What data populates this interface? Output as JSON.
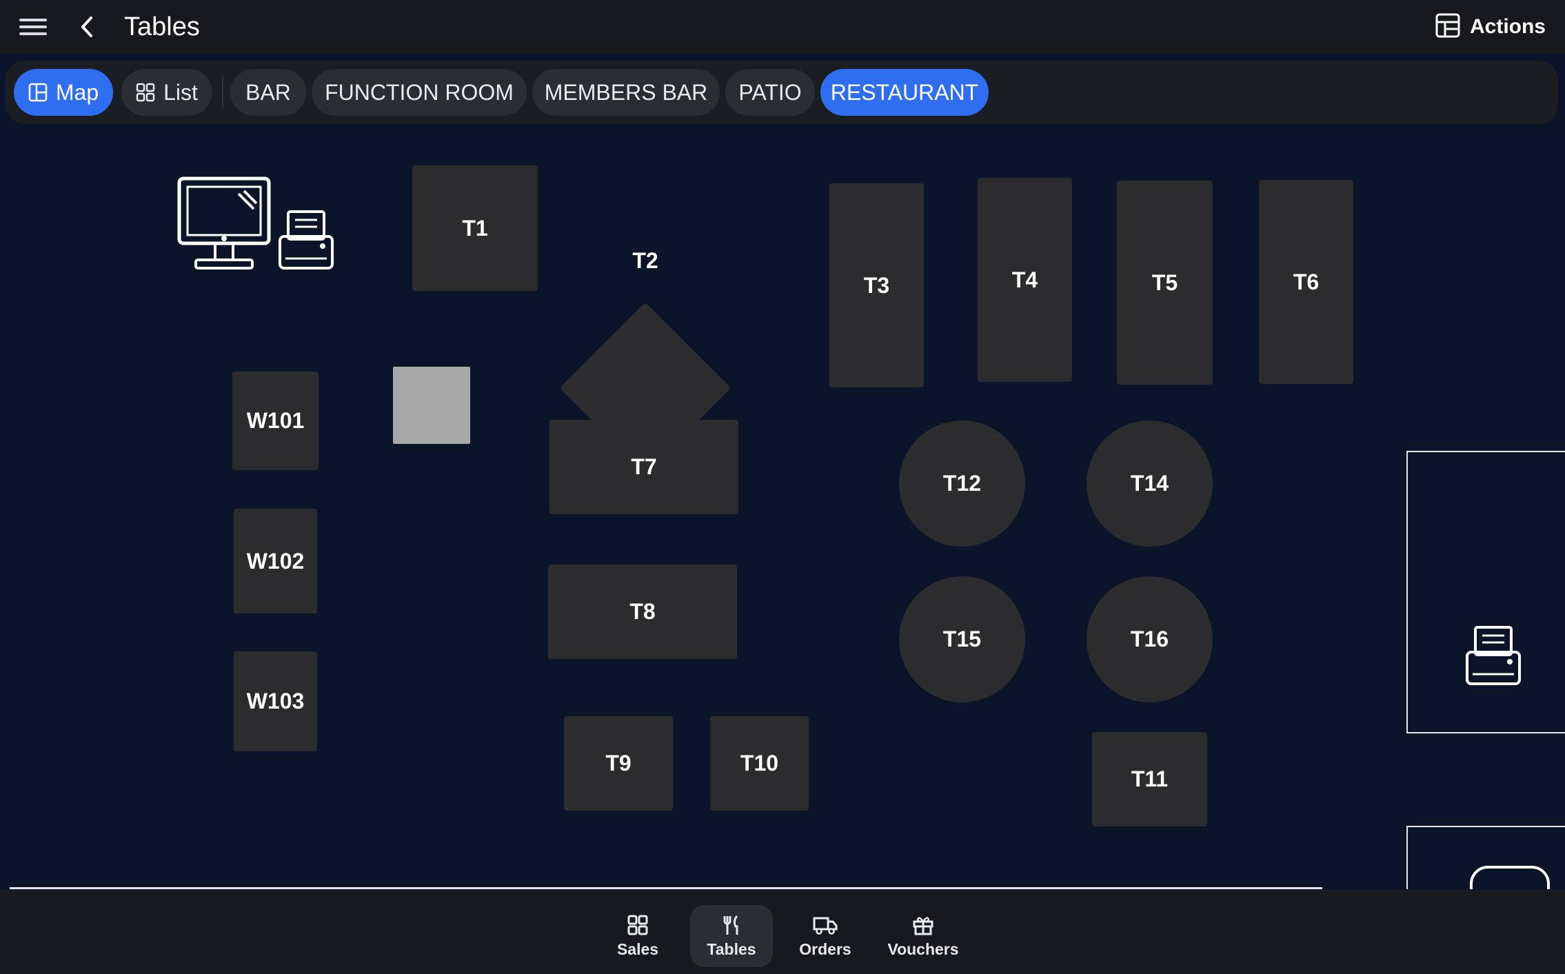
{
  "header": {
    "title": "Tables",
    "actions_label": "Actions",
    "menu_icon": "hamburger-menu-icon",
    "back_icon": "chevron-left-icon",
    "actions_icon": "layout-icon"
  },
  "view_toggle": {
    "map_label": "Map",
    "list_label": "List",
    "selected": "Map"
  },
  "areas": [
    {
      "label": "BAR",
      "active": false
    },
    {
      "label": "FUNCTION ROOM",
      "active": false
    },
    {
      "label": "MEMBERS BAR",
      "active": false
    },
    {
      "label": "PATIO",
      "active": false
    },
    {
      "label": "RESTAURANT",
      "active": true
    }
  ],
  "tables": {
    "t1": "T1",
    "t2": "T2",
    "t3": "T3",
    "t4": "T4",
    "t5": "T5",
    "t6": "T6",
    "t7": "T7",
    "t8": "T8",
    "t9": "T9",
    "t10": "T10",
    "t11": "T11",
    "t12": "T12",
    "t14": "T14",
    "t15": "T15",
    "t16": "T16",
    "w101": "W101",
    "w102": "W102",
    "w103": "W103"
  },
  "bottom_nav": [
    {
      "label": "Sales",
      "icon": "grid-icon",
      "active": false
    },
    {
      "label": "Tables",
      "icon": "utensils-icon",
      "active": true
    },
    {
      "label": "Orders",
      "icon": "truck-icon",
      "active": false
    },
    {
      "label": "Vouchers",
      "icon": "gift-icon",
      "active": false
    }
  ],
  "colors": {
    "accent": "#2f6ef0",
    "map_background": "#0b1428",
    "table": "#2c2c2e",
    "header": "#17191c"
  }
}
